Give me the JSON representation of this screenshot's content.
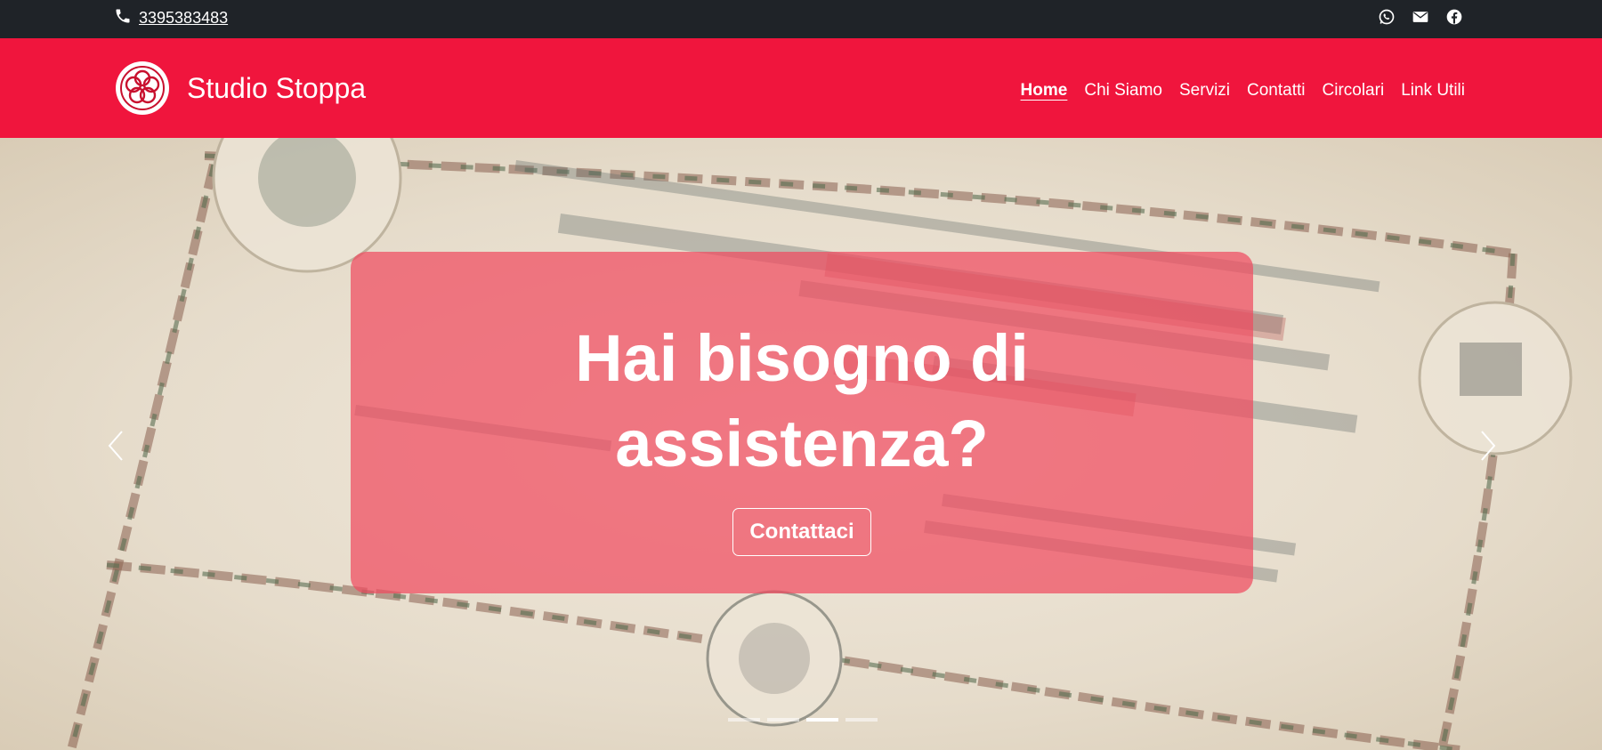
{
  "topbar": {
    "phone": "3395383483",
    "icons": [
      "phone-icon",
      "whatsapp-icon",
      "email-icon",
      "facebook-icon"
    ]
  },
  "navbar": {
    "brand": "Studio Stoppa",
    "items": [
      {
        "label": "Home",
        "active": true
      },
      {
        "label": "Chi Siamo"
      },
      {
        "label": "Servizi"
      },
      {
        "label": "Contatti"
      },
      {
        "label": "Circolari"
      },
      {
        "label": "Link Utili"
      }
    ]
  },
  "hero": {
    "title_line1": "Hai bisogno di",
    "title_line2": "assistenza?",
    "cta": "Contattaci",
    "slide_count": 4,
    "active_slide": 3
  },
  "colors": {
    "topbar": "#1f2328",
    "navbar": "#f0153d",
    "caption": "#f04b5f"
  }
}
